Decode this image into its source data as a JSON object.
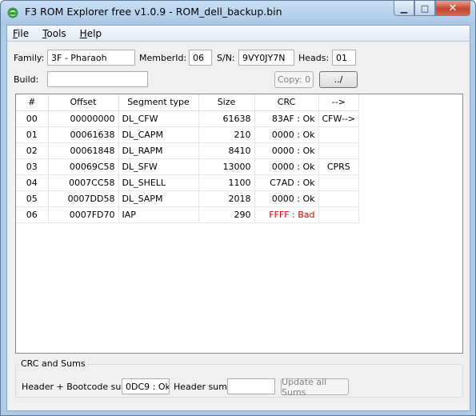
{
  "window": {
    "title": "F3 ROM Explorer free v1.0.9 - ROM_dell_backup.bin",
    "minimize": "▁",
    "maximize": "□",
    "close": "✕"
  },
  "menu": [
    "File",
    "Tools",
    "Help"
  ],
  "info": {
    "family_label": "Family:",
    "family_value": "3F - Pharaoh",
    "member_label": "MemberId:",
    "member_value": "06",
    "sn_label": "S/N:",
    "sn_value": "9VY0JY7N",
    "heads_label": "Heads:",
    "heads_value": "01",
    "build_label": "Build:",
    "build_value": "",
    "copy_button": "Copy: 0",
    "browse_button": "../"
  },
  "table": {
    "columns": [
      "#",
      "Offset",
      "Segment type",
      "Size",
      "CRC",
      "-->"
    ],
    "rows": [
      {
        "num": "00",
        "offset": "00000000",
        "type": "DL_CFW",
        "size": "61638",
        "crc": "83AF : Ok",
        "arrow": "CFW-->",
        "bad": false
      },
      {
        "num": "01",
        "offset": "00061638",
        "type": "DL_CAPM",
        "size": "210",
        "crc": "0000 : Ok",
        "arrow": "",
        "bad": false
      },
      {
        "num": "02",
        "offset": "00061848",
        "type": "DL_RAPM",
        "size": "8410",
        "crc": "0000 : Ok",
        "arrow": "",
        "bad": false
      },
      {
        "num": "03",
        "offset": "00069C58",
        "type": "DL_SFW",
        "size": "13000",
        "crc": "0000 : Ok",
        "arrow": "CPRS",
        "bad": false
      },
      {
        "num": "04",
        "offset": "0007CC58",
        "type": "DL_SHELL",
        "size": "1100",
        "crc": "C7AD : Ok",
        "arrow": "",
        "bad": false
      },
      {
        "num": "05",
        "offset": "0007DD58",
        "type": "DL_SAPM",
        "size": "2018",
        "crc": "0000 : Ok",
        "arrow": "",
        "bad": false
      },
      {
        "num": "06",
        "offset": "0007FD70",
        "type": "IAP",
        "size": "290",
        "crc": "FFFF : Bad",
        "arrow": "",
        "bad": true
      }
    ]
  },
  "sums": {
    "group_title": "CRC and Sums",
    "header_boot_label": "Header + Bootcode sum:",
    "header_boot_value": "0DC9 : Ok",
    "header_label": "Header sum:",
    "header_value": "",
    "update_button": "Update all Sums"
  },
  "colors": {
    "bad": "#e00000",
    "title_bar": "#aeccea"
  }
}
